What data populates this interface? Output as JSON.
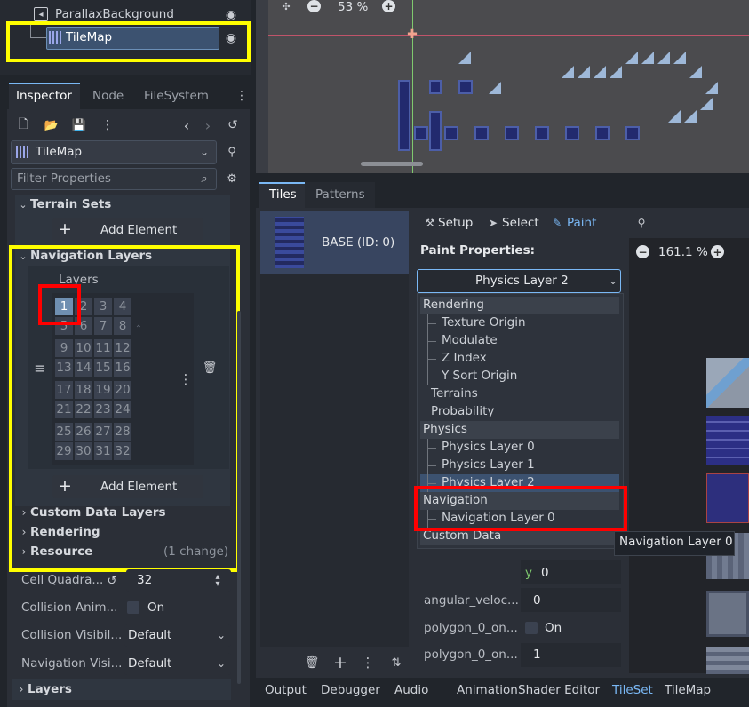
{
  "scene_tree": {
    "items": [
      {
        "label": "ParallaxBackground"
      },
      {
        "label": "TileMap"
      }
    ]
  },
  "viewport": {
    "zoom": "53 %"
  },
  "inspector_tabs": [
    "Inspector",
    "Node",
    "FileSystem"
  ],
  "inspector": {
    "object_name": "TileMap",
    "filter_placeholder": "Filter Properties",
    "terrain_sets": "Terrain Sets",
    "add_element": "Add Element",
    "navigation_layers": "Navigation Layers",
    "layers_label": "Layers",
    "layer_cells": [
      "1",
      "2",
      "3",
      "4",
      "5",
      "6",
      "7",
      "8",
      "9",
      "10",
      "11",
      "12",
      "13",
      "14",
      "15",
      "16",
      "17",
      "18",
      "19",
      "20",
      "21",
      "22",
      "23",
      "24",
      "25",
      "26",
      "27",
      "28",
      "29",
      "30",
      "31",
      "32"
    ],
    "custom_data_layers": "Custom Data Layers",
    "rendering": "Rendering",
    "resource": "Resource",
    "resource_changes": "(1 change)",
    "cell_quadrant_label": "Cell Quadra...",
    "cell_quadrant_value": "32",
    "collision_anim_label": "Collision Anim...",
    "collision_anim_value": "On",
    "collision_visib_label": "Collision Visibil...",
    "collision_visib_value": "Default",
    "navigation_visib_label": "Navigation Visi...",
    "navigation_visib_value": "Default",
    "layers": "Layers"
  },
  "tileset_tabs": [
    "Tiles",
    "Patterns"
  ],
  "tileset": {
    "source_name": "BASE (ID: 0)",
    "modes": [
      "Setup",
      "Select",
      "Paint"
    ],
    "paint_properties": "Paint Properties:",
    "selected_property": "Physics Layer 2",
    "zoom": "161.1 %",
    "dropdown": [
      {
        "label": "Rendering",
        "type": "header"
      },
      {
        "label": "Texture Origin",
        "type": "child"
      },
      {
        "label": "Modulate",
        "type": "child"
      },
      {
        "label": "Z Index",
        "type": "child"
      },
      {
        "label": "Y Sort Origin",
        "type": "child"
      },
      {
        "label": "Terrains",
        "type": "item"
      },
      {
        "label": "Probability",
        "type": "item"
      },
      {
        "label": "Physics",
        "type": "header"
      },
      {
        "label": "Physics Layer 0",
        "type": "child"
      },
      {
        "label": "Physics Layer 1",
        "type": "child"
      },
      {
        "label": "Physics Layer 2",
        "type": "child-selected"
      },
      {
        "label": "Navigation",
        "type": "header"
      },
      {
        "label": "Navigation Layer 0",
        "type": "child"
      },
      {
        "label": "Custom Data",
        "type": "header"
      }
    ],
    "props": {
      "y_label": "y",
      "y_value": "0",
      "angular_label": "angular_veloc...",
      "angular_value": "0",
      "poly_on_label": "polygon_0_on...",
      "poly_on_value": "On",
      "poly_on2_label": "polygon_0_on...",
      "poly_on2_value": "1"
    },
    "tooltip": "Navigation Layer 0"
  },
  "bottom_tabs": [
    "Output",
    "Debugger",
    "Audio",
    "Animation",
    "Shader Editor",
    "TileSet",
    "TileMap"
  ],
  "colors": {
    "accent": "#7ab8f5",
    "highlight_yellow": "#ffff00",
    "highlight_red": "#ff0000"
  }
}
